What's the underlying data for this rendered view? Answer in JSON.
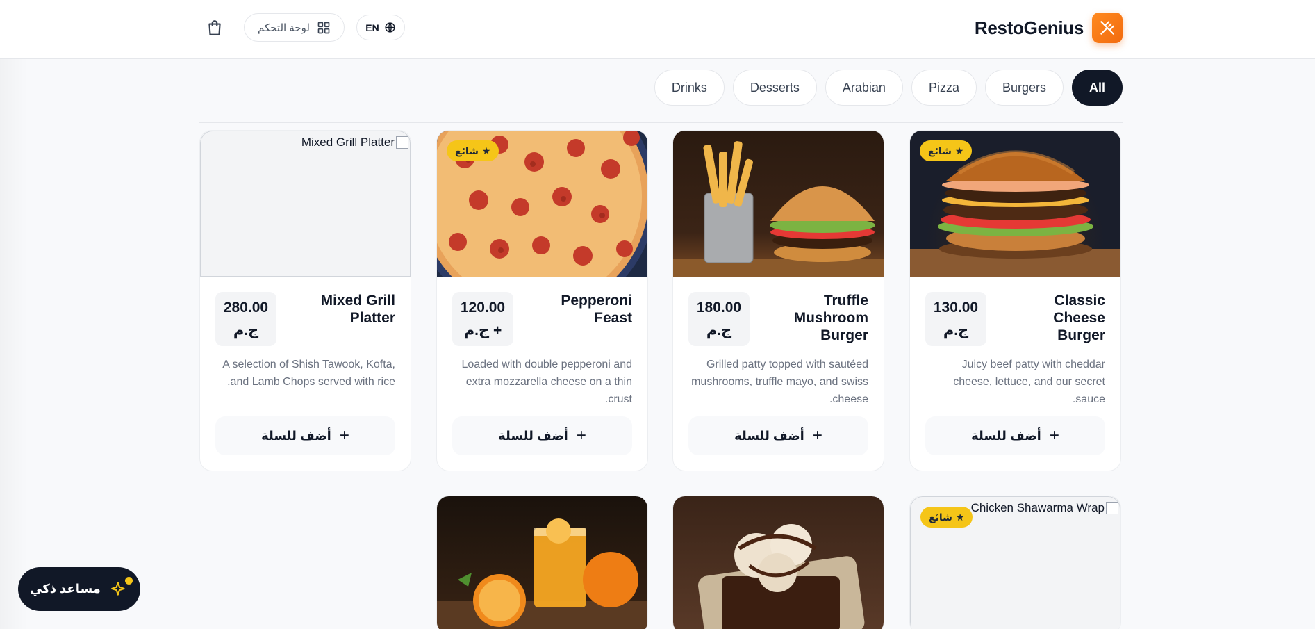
{
  "header": {
    "brand_name": "RestoGenius",
    "dashboard_label": "لوحة التحكم",
    "lang_label": "EN"
  },
  "filters": [
    "All",
    "Burgers",
    "Pizza",
    "Arabian",
    "Desserts",
    "Drinks"
  ],
  "active_filter": "All",
  "currency": "ج.م",
  "add_to_cart_label": "أضف للسلة",
  "popular_badge": "شائع",
  "products": [
    {
      "name": "Classic Cheese Burger",
      "price": "130.00",
      "description": "Juicy beef patty with cheddar cheese, lettuce, and our secret sauce.",
      "popular": true,
      "image": "burger-photo"
    },
    {
      "name": "Truffle Mushroom Burger",
      "price": "180.00",
      "description": "Grilled patty topped with sautéed mushrooms, truffle mayo, and swiss cheese.",
      "popular": false,
      "image": "burger-fries-photo"
    },
    {
      "name": "Pepperoni Feast",
      "price": "120.00",
      "price_suffix": "+",
      "description": "Loaded with double pepperoni and extra mozzarella cheese on a thin crust.",
      "popular": true,
      "image": "pizza-photo"
    },
    {
      "name": "Mixed Grill Platter",
      "price": "280.00",
      "description": "A selection of Shish Tawook, Kofta, and Lamb Chops served with rice.",
      "popular": false,
      "image_alt": "Mixed Grill Platter"
    },
    {
      "name": "Chicken Shawarma Wrap",
      "popular": true,
      "image_alt": "Chicken Shawarma Wrap"
    },
    {
      "image": "brownie-photo",
      "popular": false
    },
    {
      "image": "orange-juice-photo",
      "popular": false
    }
  ],
  "assistant_label": "مساعد ذكي",
  "colors": {
    "accent": "#f26b0f",
    "dark": "#111827",
    "badge": "#f5c518"
  }
}
